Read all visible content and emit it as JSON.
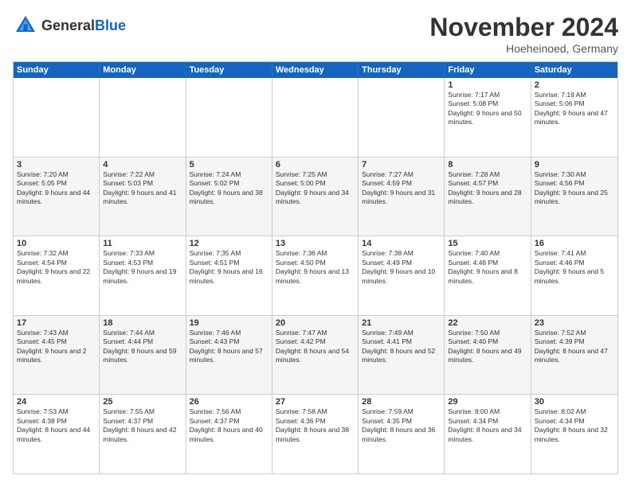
{
  "header": {
    "logo_general": "General",
    "logo_blue": "Blue",
    "title": "November 2024",
    "location": "Hoeheinoed, Germany"
  },
  "weekdays": [
    "Sunday",
    "Monday",
    "Tuesday",
    "Wednesday",
    "Thursday",
    "Friday",
    "Saturday"
  ],
  "rows": [
    {
      "alt": false,
      "cells": [
        {
          "day": "",
          "text": ""
        },
        {
          "day": "",
          "text": ""
        },
        {
          "day": "",
          "text": ""
        },
        {
          "day": "",
          "text": ""
        },
        {
          "day": "",
          "text": ""
        },
        {
          "day": "1",
          "text": "Sunrise: 7:17 AM\nSunset: 5:08 PM\nDaylight: 9 hours and 50 minutes."
        },
        {
          "day": "2",
          "text": "Sunrise: 7:19 AM\nSunset: 5:06 PM\nDaylight: 9 hours and 47 minutes."
        }
      ]
    },
    {
      "alt": true,
      "cells": [
        {
          "day": "3",
          "text": "Sunrise: 7:20 AM\nSunset: 5:05 PM\nDaylight: 9 hours and 44 minutes."
        },
        {
          "day": "4",
          "text": "Sunrise: 7:22 AM\nSunset: 5:03 PM\nDaylight: 9 hours and 41 minutes."
        },
        {
          "day": "5",
          "text": "Sunrise: 7:24 AM\nSunset: 5:02 PM\nDaylight: 9 hours and 38 minutes."
        },
        {
          "day": "6",
          "text": "Sunrise: 7:25 AM\nSunset: 5:00 PM\nDaylight: 9 hours and 34 minutes."
        },
        {
          "day": "7",
          "text": "Sunrise: 7:27 AM\nSunset: 4:59 PM\nDaylight: 9 hours and 31 minutes."
        },
        {
          "day": "8",
          "text": "Sunrise: 7:28 AM\nSunset: 4:57 PM\nDaylight: 9 hours and 28 minutes."
        },
        {
          "day": "9",
          "text": "Sunrise: 7:30 AM\nSunset: 4:56 PM\nDaylight: 9 hours and 25 minutes."
        }
      ]
    },
    {
      "alt": false,
      "cells": [
        {
          "day": "10",
          "text": "Sunrise: 7:32 AM\nSunset: 4:54 PM\nDaylight: 9 hours and 22 minutes."
        },
        {
          "day": "11",
          "text": "Sunrise: 7:33 AM\nSunset: 4:53 PM\nDaylight: 9 hours and 19 minutes."
        },
        {
          "day": "12",
          "text": "Sunrise: 7:35 AM\nSunset: 4:51 PM\nDaylight: 9 hours and 16 minutes."
        },
        {
          "day": "13",
          "text": "Sunrise: 7:36 AM\nSunset: 4:50 PM\nDaylight: 9 hours and 13 minutes."
        },
        {
          "day": "14",
          "text": "Sunrise: 7:38 AM\nSunset: 4:49 PM\nDaylight: 9 hours and 10 minutes."
        },
        {
          "day": "15",
          "text": "Sunrise: 7:40 AM\nSunset: 4:48 PM\nDaylight: 9 hours and 8 minutes."
        },
        {
          "day": "16",
          "text": "Sunrise: 7:41 AM\nSunset: 4:46 PM\nDaylight: 9 hours and 5 minutes."
        }
      ]
    },
    {
      "alt": true,
      "cells": [
        {
          "day": "17",
          "text": "Sunrise: 7:43 AM\nSunset: 4:45 PM\nDaylight: 9 hours and 2 minutes."
        },
        {
          "day": "18",
          "text": "Sunrise: 7:44 AM\nSunset: 4:44 PM\nDaylight: 8 hours and 59 minutes."
        },
        {
          "day": "19",
          "text": "Sunrise: 7:46 AM\nSunset: 4:43 PM\nDaylight: 8 hours and 57 minutes."
        },
        {
          "day": "20",
          "text": "Sunrise: 7:47 AM\nSunset: 4:42 PM\nDaylight: 8 hours and 54 minutes."
        },
        {
          "day": "21",
          "text": "Sunrise: 7:49 AM\nSunset: 4:41 PM\nDaylight: 8 hours and 52 minutes."
        },
        {
          "day": "22",
          "text": "Sunrise: 7:50 AM\nSunset: 4:40 PM\nDaylight: 8 hours and 49 minutes."
        },
        {
          "day": "23",
          "text": "Sunrise: 7:52 AM\nSunset: 4:39 PM\nDaylight: 8 hours and 47 minutes."
        }
      ]
    },
    {
      "alt": false,
      "cells": [
        {
          "day": "24",
          "text": "Sunrise: 7:53 AM\nSunset: 4:38 PM\nDaylight: 8 hours and 44 minutes."
        },
        {
          "day": "25",
          "text": "Sunrise: 7:55 AM\nSunset: 4:37 PM\nDaylight: 8 hours and 42 minutes."
        },
        {
          "day": "26",
          "text": "Sunrise: 7:56 AM\nSunset: 4:37 PM\nDaylight: 8 hours and 40 minutes."
        },
        {
          "day": "27",
          "text": "Sunrise: 7:58 AM\nSunset: 4:36 PM\nDaylight: 8 hours and 38 minutes."
        },
        {
          "day": "28",
          "text": "Sunrise: 7:59 AM\nSunset: 4:35 PM\nDaylight: 8 hours and 36 minutes."
        },
        {
          "day": "29",
          "text": "Sunrise: 8:00 AM\nSunset: 4:34 PM\nDaylight: 8 hours and 34 minutes."
        },
        {
          "day": "30",
          "text": "Sunrise: 8:02 AM\nSunset: 4:34 PM\nDaylight: 8 hours and 32 minutes."
        }
      ]
    }
  ]
}
